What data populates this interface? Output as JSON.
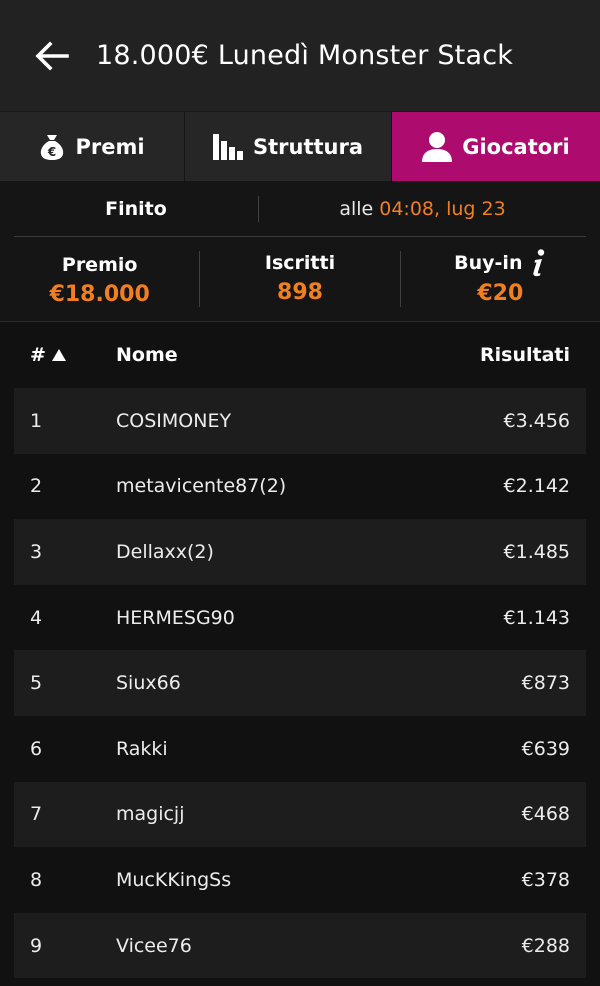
{
  "header": {
    "title": "18.000€ Lunedì Monster Stack",
    "back_icon": "arrow-left-icon"
  },
  "tabs": [
    {
      "label": "Premi",
      "icon": "money-bag-icon",
      "active": false
    },
    {
      "label": "Struttura",
      "icon": "bar-chart-icon",
      "active": false
    },
    {
      "label": "Giocatori",
      "icon": "user-icon",
      "active": true
    }
  ],
  "status": {
    "state": "Finito",
    "time_prefix": "alle ",
    "time": "04:08, lug 23"
  },
  "stats": {
    "premio_label": "Premio",
    "premio_value": "€18.000",
    "iscritti_label": "Iscritti",
    "iscritti_value": "898",
    "buyin_label": "Buy-in",
    "buyin_value": "€20"
  },
  "table": {
    "col_rank": "#",
    "col_name": "Nome",
    "col_result": "Risultati",
    "rows": [
      {
        "rank": "1",
        "name": "COSIMONEY",
        "result": "€3.456"
      },
      {
        "rank": "2",
        "name": "metavicente87(2)",
        "result": "€2.142"
      },
      {
        "rank": "3",
        "name": "Dellaxx(2)",
        "result": "€1.485"
      },
      {
        "rank": "4",
        "name": "HERMESG90",
        "result": "€1.143"
      },
      {
        "rank": "5",
        "name": "Siux66",
        "result": "€873"
      },
      {
        "rank": "6",
        "name": "Rakki",
        "result": "€639"
      },
      {
        "rank": "7",
        "name": "magicjj",
        "result": "€468"
      },
      {
        "rank": "8",
        "name": "MucKKingSs",
        "result": "€378"
      },
      {
        "rank": "9",
        "name": "Vicee76",
        "result": "€288"
      }
    ]
  },
  "colors": {
    "accent_magenta": "#ad0c6e",
    "accent_orange": "#f07f1f"
  }
}
